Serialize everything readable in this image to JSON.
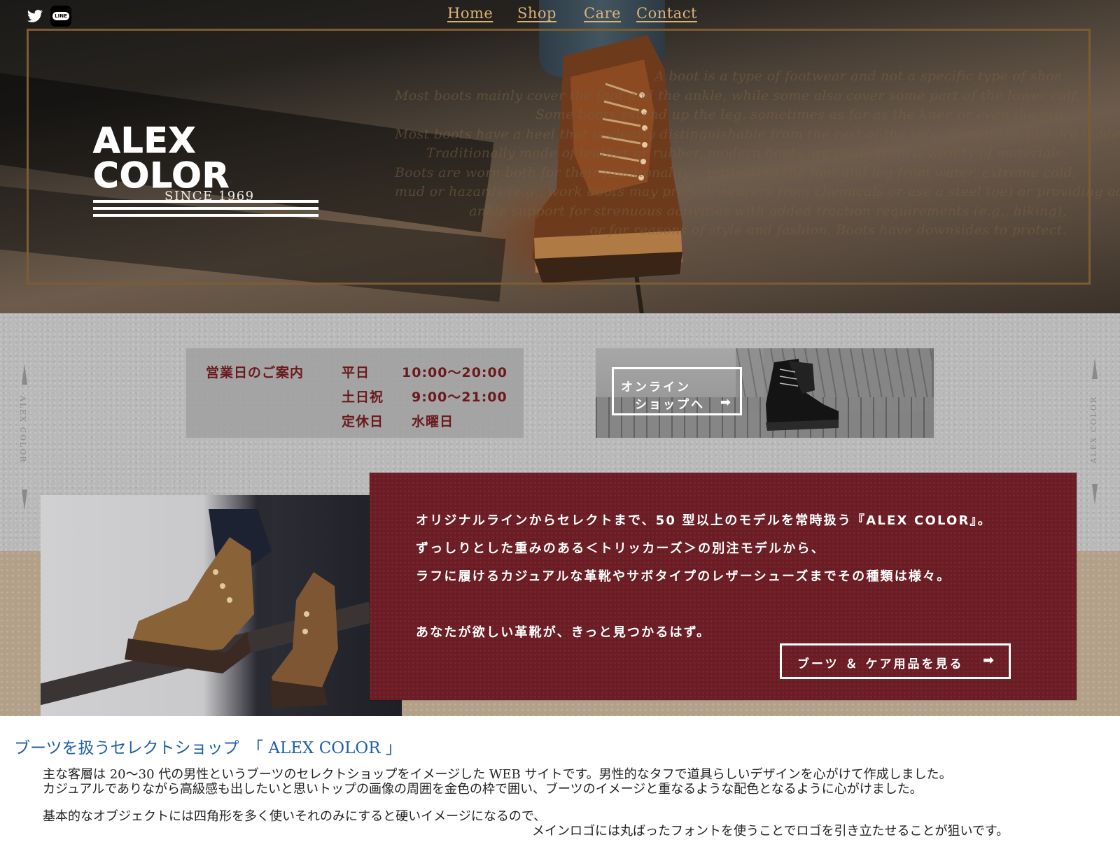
{
  "social": {
    "twitter_icon": "twitter-icon",
    "line_icon": "line-icon",
    "line_text": "LINE"
  },
  "nav": [
    {
      "label": "Home"
    },
    {
      "label": "Shop"
    },
    {
      "label": "Care"
    },
    {
      "label": "Contact"
    }
  ],
  "hero": {
    "logo_text": "ALEX COLOR",
    "since": "SINCE 1969",
    "poem_lines": [
      "A boot is a type of footwear and not a specific type of shoe.",
      "Most boots mainly cover the foot and the ankle, while some also cover some part of the lower calf.",
      "Some boots extend up the leg, sometimes as far as the knee or even the hip.",
      "Most boots have a heel that is clearly distinguishable from the rest of the sole, even if the two are made of one piece.",
      "Traditionally made of leather or rubber, modern boots are made from a variety of materials.",
      "Boots are worn both for their functionality – protecting the foot and leg from water, extreme cold,",
      "mud or hazards (e.g., work boots may protect wearers from chemicals or use a steel toe) or providing additional",
      "ankle support for strenuous activities with added traction requirements (e.g., hiking),",
      "or for reasons of style and fashion. Boots have downsides to protect."
    ]
  },
  "side_label": "ALEX COLOR",
  "hours": {
    "heading": "営業日のご案内",
    "rows": [
      {
        "day": "平日",
        "time": "10:00～20:00"
      },
      {
        "day": "土日祝",
        "time": "9:00～21:00"
      },
      {
        "day": "定休日",
        "time": "水曜日"
      }
    ]
  },
  "online_shop": {
    "line1": "オンライン",
    "line2": "ショップへ",
    "arrow_icon": "arrow-right-icon",
    "arrow": "➡"
  },
  "description": {
    "lines": [
      "オリジナルラインからセレクトまで、50 型以上のモデルを常時扱う『ALEX COLOR』。",
      "ずっしりとした重みのある＜トリッカーズ＞の別注モデルから、",
      "ラフに履けるカジュアルな革靴やサボタイプのレザーシューズまでその種類は様々。",
      "あなたが欲しい革靴が、きっと見つかるはず。"
    ],
    "cta_label": "ブーツ ＆ ケア用品を見る",
    "cta_arrow": "➡"
  },
  "about": {
    "title": "ブーツを扱うセレクトショップ　「 ALEX COLOR 」",
    "p1_line1": "主な客層は 20～30 代の男性というブーツのセレクトショップをイメージした WEB サイトです。男性的なタフで道具らしいデザインを心がけて作成しました。",
    "p1_line2": "カジュアルでありながら高級感も出したいと思いトップの画像の周囲を金色の枠で囲い、ブーツのイメージと重なるような配色となるように心がけました。",
    "p2_line1": "基本的なオブジェクトには四角形を多く使いそれのみにすると硬いイメージになるので、",
    "p2_line2": "メインロゴには丸ばったフォントを使うことでロゴを引き立たせることが狙いです。"
  },
  "colors": {
    "gold": "#7c5c33",
    "burgundy": "#6b1c24",
    "nav": "#d9b27a",
    "link_blue": "#1f5fa8"
  }
}
